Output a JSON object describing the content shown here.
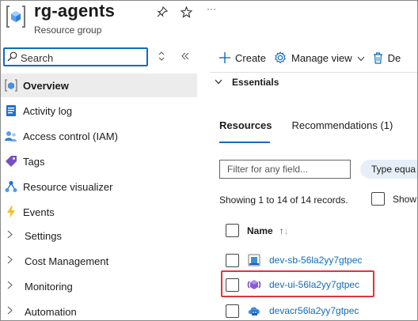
{
  "header": {
    "title": "rg-agents",
    "subtitle": "Resource group",
    "more": "···"
  },
  "sidebar": {
    "search_placeholder": "Search",
    "items": [
      {
        "label": "Overview",
        "icon": "overview-icon",
        "active": true
      },
      {
        "label": "Activity log",
        "icon": "activity-log-icon"
      },
      {
        "label": "Access control (IAM)",
        "icon": "iam-icon"
      },
      {
        "label": "Tags",
        "icon": "tag-icon"
      },
      {
        "label": "Resource visualizer",
        "icon": "visualizer-icon"
      },
      {
        "label": "Events",
        "icon": "lightning-icon"
      },
      {
        "label": "Settings",
        "expandable": true
      },
      {
        "label": "Cost Management",
        "expandable": true
      },
      {
        "label": "Monitoring",
        "expandable": true
      },
      {
        "label": "Automation",
        "expandable": true
      }
    ]
  },
  "toolbar": {
    "create": "Create",
    "manage_view": "Manage view",
    "delete_partial": "De"
  },
  "essentials": {
    "label": "Essentials"
  },
  "tabs": [
    {
      "label": "Resources",
      "active": true
    },
    {
      "label": "Recommendations (1)"
    }
  ],
  "filter": {
    "placeholder": "Filter for any field...",
    "type_pill": "Type equa"
  },
  "records": {
    "text": "Showing 1 to 14 of 14 records.",
    "show_label": "Show"
  },
  "table": {
    "name_header": "Name",
    "rows": [
      {
        "name": "dev-sb-56la2yy7gtpec",
        "icon": "service-bus-icon"
      },
      {
        "name": "dev-ui-56la2yy7gtpec",
        "icon": "container-app-icon",
        "highlighted": true
      },
      {
        "name": "devacr56la2yy7gtpec",
        "icon": "container-registry-icon"
      }
    ]
  },
  "colors": {
    "accent": "#0f6cbd",
    "highlight": "#e0353b",
    "active_bg": "#ececec"
  }
}
